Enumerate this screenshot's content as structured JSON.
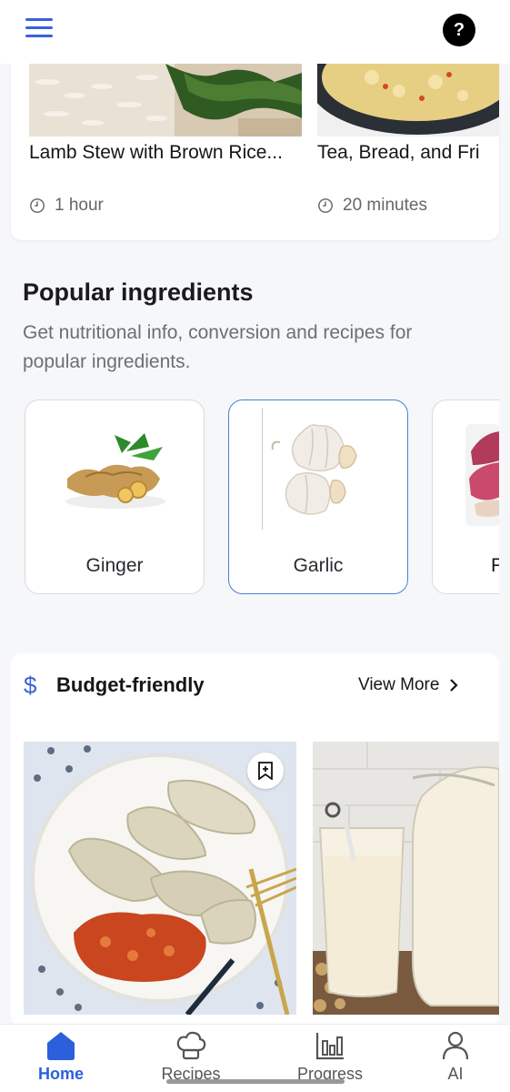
{
  "colors": {
    "accent": "#3a63d6",
    "nav_active": "#2b5fdc",
    "card_selected_border": "#4a7fd0"
  },
  "header": {
    "menu_icon": "hamburger-icon",
    "help_label": "?"
  },
  "recipes_top": [
    {
      "title": "Lamb Stew with Brown Rice...",
      "time": "1 hour"
    },
    {
      "title": "Tea, Bread, and Fri",
      "time": "20 minutes"
    }
  ],
  "popular": {
    "title": "Popular ingredients",
    "subtitle": "Get nutritional info, conversion and recipes for popular ingredients.",
    "items": [
      {
        "label": "Ginger"
      },
      {
        "label": "Garlic"
      },
      {
        "label": "F"
      }
    ]
  },
  "budget": {
    "icon": "dollar-icon",
    "title": "Budget-friendly",
    "view_more": "View More"
  },
  "nav": {
    "items": [
      {
        "label": "Home",
        "icon": "home-icon"
      },
      {
        "label": "Recipes",
        "icon": "chef-hat-icon"
      },
      {
        "label": "Progress",
        "icon": "bar-chart-icon"
      },
      {
        "label": "AI",
        "icon": "person-icon"
      }
    ]
  }
}
